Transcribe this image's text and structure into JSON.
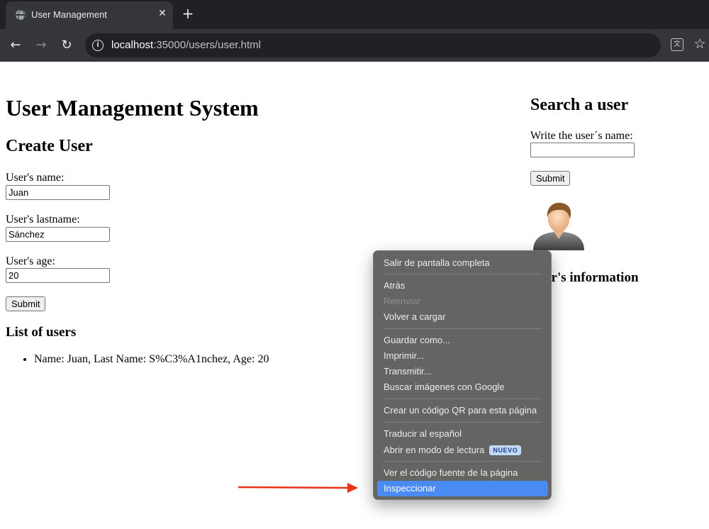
{
  "browser": {
    "tab_title": "User Management",
    "tab_close": "✕",
    "new_tab": "+",
    "url_host": "localhost",
    "url_path": ":35000/users/user.html",
    "icons": [
      "globe-icon",
      "close-icon",
      "plus-icon",
      "back-icon",
      "forward-icon",
      "reload-icon",
      "info-icon",
      "translate-icon",
      "star-icon"
    ]
  },
  "page": {
    "title": "User Management System",
    "create_user": {
      "heading": "Create User",
      "name_label": "User's name:",
      "name_value": "Juan",
      "lastname_label": "User's lastname:",
      "lastname_value": "Sánchez",
      "age_label": "User's age:",
      "age_value": "20",
      "submit_label": "Submit"
    },
    "list": {
      "heading": "List of users",
      "items": [
        "Name: Juan, Last Name: S%C3%A1nchez, Age: 20"
      ]
    },
    "search": {
      "heading": "Search a user",
      "label": "Write the user´s name:",
      "value": "",
      "submit_label": "Submit"
    },
    "info_heading": "User's information"
  },
  "context_menu": {
    "items": [
      {
        "label": "Salir de pantalla completa"
      },
      {
        "label": "Atrás"
      },
      {
        "label": "Reenviar",
        "disabled": true
      },
      {
        "label": "Volver a cargar"
      },
      {
        "label": "Guardar como..."
      },
      {
        "label": "Imprimir..."
      },
      {
        "label": "Transmitir..."
      },
      {
        "label": "Buscar imágenes con Google"
      },
      {
        "label": "Crear un código QR para esta página"
      },
      {
        "label": "Traducir al español"
      },
      {
        "label": "Abrir en modo de lectura",
        "badge": "NUEVO"
      },
      {
        "label": "Ver el código fuente de la página"
      },
      {
        "label": "Inspeccionar",
        "selected": true
      }
    ]
  },
  "colors": {
    "menu_background": "#646462",
    "menu_selected": "#4a8af3",
    "arrow": "#e8321b"
  }
}
